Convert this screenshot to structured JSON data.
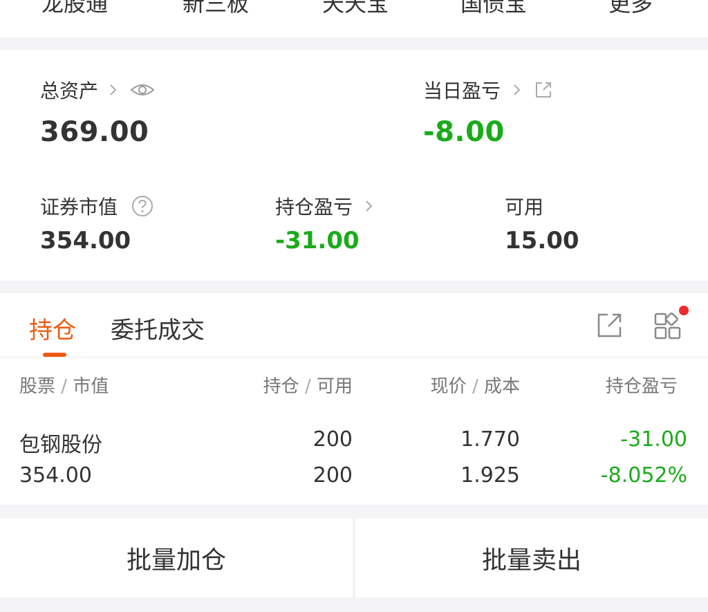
{
  "topnav": {
    "items": [
      "龙股通",
      "新三板",
      "天天宝",
      "国债宝",
      "更多"
    ]
  },
  "summary": {
    "total_assets": {
      "label": "总资产",
      "value": "369.00"
    },
    "daily_pnl": {
      "label": "当日盈亏",
      "value": "-8.00"
    },
    "market_value": {
      "label": "证券市值",
      "value": "354.00"
    },
    "position_pnl": {
      "label": "持仓盈亏",
      "value": "-31.00"
    },
    "available": {
      "label": "可用",
      "value": "15.00"
    }
  },
  "tabs": {
    "positions": "持仓",
    "orders": "委托成交"
  },
  "table": {
    "headers": {
      "stock": "股票",
      "market_value": "市值",
      "position": "持仓",
      "available": "可用",
      "price": "现价",
      "cost": "成本",
      "pnl": "持仓盈亏"
    },
    "rows": [
      {
        "name": "包钢股份",
        "market_value": "354.00",
        "position": "200",
        "available": "200",
        "price": "1.770",
        "cost": "1.925",
        "pnl": "-31.00",
        "pnl_pct": "-8.052%"
      }
    ]
  },
  "actions": {
    "batch_add": "批量加仓",
    "batch_sell": "批量卖出"
  },
  "colors": {
    "accent": "#ee5a0e",
    "loss_green": "#1aab1a",
    "badge_red": "#ee2a2a"
  }
}
